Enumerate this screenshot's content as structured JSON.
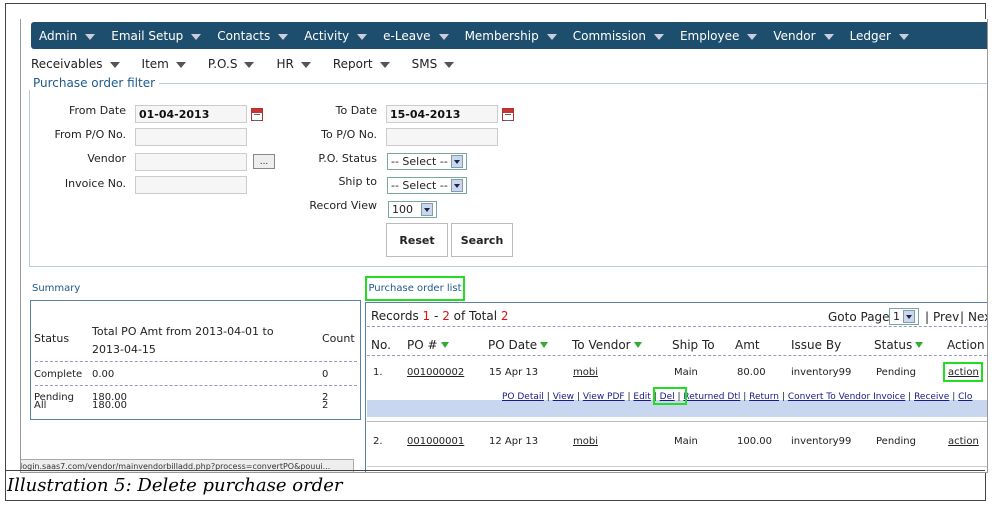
{
  "main_nav": [
    "Admin",
    "Email Setup",
    "Contacts",
    "Activity",
    "e-Leave",
    "Membership",
    "Commission",
    "Employee",
    "Vendor",
    "Ledger"
  ],
  "sub_nav": [
    "Receivables",
    "Item",
    "P.O.S",
    "HR",
    "Report",
    "SMS"
  ],
  "filter": {
    "title": "Purchase order filter",
    "from_date_label": "From Date",
    "from_date_value": "01-04-2013",
    "to_date_label": "To Date",
    "to_date_value": "15-04-2013",
    "from_po_label": "From P/O No.",
    "to_po_label": "To P/O No.",
    "vendor_label": "Vendor",
    "vendor_browse": "...",
    "po_status_label": "P.O. Status",
    "po_status_value": "-- Select --",
    "invoice_label": "Invoice No.",
    "ship_to_label": "Ship to",
    "ship_to_value": "-- Select --",
    "record_view_label": "Record View",
    "record_view_value": "100",
    "reset": "Reset",
    "search": "Search"
  },
  "summary": {
    "title": "Summary",
    "headers": [
      "Status",
      "Total PO Amt from 2013-04-01 to 2013-04-15",
      "Count"
    ],
    "rows": [
      {
        "status": "Complete",
        "amt": "0.00",
        "count": "0"
      },
      {
        "status": "Pending",
        "amt": "180.00",
        "count": "2"
      },
      {
        "status": "All",
        "amt": "180.00",
        "count": "2"
      }
    ]
  },
  "list": {
    "title": "Purchase order list",
    "records_prefix": "Records",
    "from": "1",
    "dash": "-",
    "to": "2",
    "of_total": "of Total",
    "total": "2",
    "goto_page": "Goto Page",
    "page_value": "1",
    "prev": "Prev",
    "next": "Nex",
    "headers": [
      "No.",
      "PO #",
      "PO Date",
      "To Vendor",
      "Ship To",
      "Amt",
      "Issue By",
      "Status",
      "Action"
    ],
    "rows": [
      {
        "no": "1.",
        "po": "001000002",
        "date": "15 Apr 13",
        "vendor": "mobi",
        "ship": "Main",
        "amt": "80.00",
        "by": "inventory99",
        "status": "Pending",
        "action": "action"
      },
      {
        "no": "2.",
        "po": "001000001",
        "date": "12 Apr 13",
        "vendor": "mobi",
        "ship": "Main",
        "amt": "100.00",
        "by": "inventory99",
        "status": "Pending",
        "action": "action"
      }
    ],
    "actions": [
      "PO Detail",
      "View",
      "View PDF",
      "Edit",
      "Del",
      "Returned Dtl",
      "Return",
      "Convert To Vendor Invoice",
      "Receive",
      "Clo"
    ],
    "sep": "|"
  },
  "statusbar": "login.saas7.com/vendor/mainvendorbilladd.php?process=convertPO&pouui...",
  "caption": "Illustration 5: Delete purchase order"
}
